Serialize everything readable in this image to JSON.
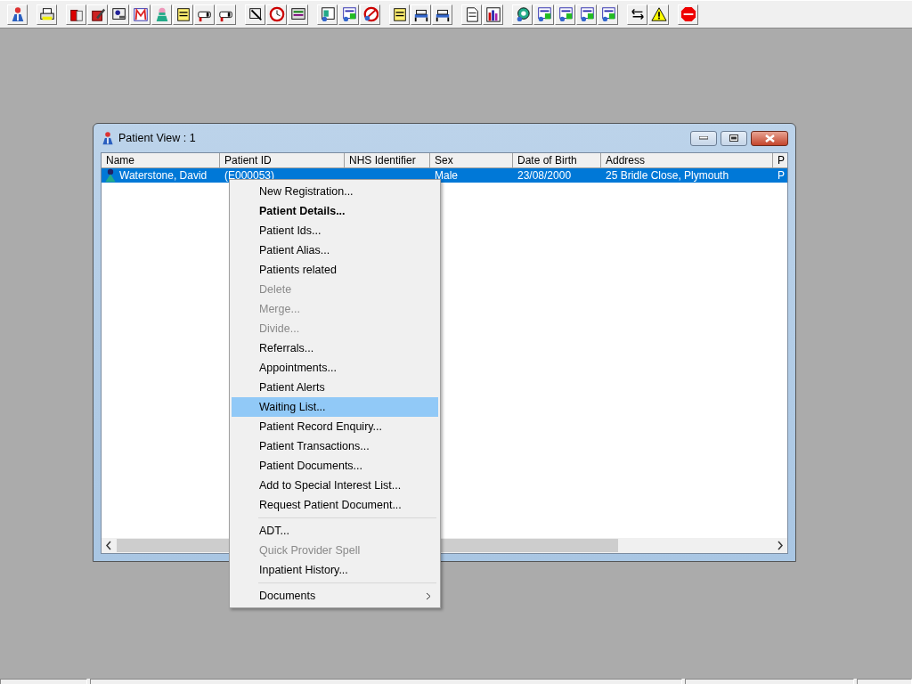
{
  "window": {
    "title": "Patient View : 1"
  },
  "table": {
    "columns": [
      "Name",
      "Patient ID",
      "NHS Identifier",
      "Sex",
      "Date of Birth",
      "Address",
      "P"
    ],
    "rows": [
      {
        "selected": true,
        "cells": [
          "Waterstone, David",
          "(E000053)",
          "",
          "Male",
          "23/08/2000",
          "25 Bridle Close, Plymouth",
          "P"
        ]
      }
    ]
  },
  "context_menu": {
    "groups": [
      [
        {
          "label": "New Registration...",
          "default": false,
          "disabled": false,
          "selected": false,
          "has_submenu": false
        },
        {
          "label": "Patient Details...",
          "default": true,
          "disabled": false,
          "selected": false,
          "has_submenu": false
        },
        {
          "label": "Patient Ids...",
          "default": false,
          "disabled": false,
          "selected": false,
          "has_submenu": false
        },
        {
          "label": "Patient Alias...",
          "default": false,
          "disabled": false,
          "selected": false,
          "has_submenu": false
        },
        {
          "label": "Patients related",
          "default": false,
          "disabled": false,
          "selected": false,
          "has_submenu": false
        },
        {
          "label": "Delete",
          "default": false,
          "disabled": true,
          "selected": false,
          "has_submenu": false
        },
        {
          "label": "Merge...",
          "default": false,
          "disabled": true,
          "selected": false,
          "has_submenu": false
        },
        {
          "label": "Divide...",
          "default": false,
          "disabled": true,
          "selected": false,
          "has_submenu": false
        },
        {
          "label": "Referrals...",
          "default": false,
          "disabled": false,
          "selected": false,
          "has_submenu": false
        },
        {
          "label": "Appointments...",
          "default": false,
          "disabled": false,
          "selected": false,
          "has_submenu": false
        },
        {
          "label": "Patient Alerts",
          "default": false,
          "disabled": false,
          "selected": false,
          "has_submenu": false
        },
        {
          "label": "Waiting List...",
          "default": false,
          "disabled": false,
          "selected": true,
          "has_submenu": false
        },
        {
          "label": "Patient Record Enquiry...",
          "default": false,
          "disabled": false,
          "selected": false,
          "has_submenu": false
        },
        {
          "label": "Patient Transactions...",
          "default": false,
          "disabled": false,
          "selected": false,
          "has_submenu": false
        },
        {
          "label": "Patient Documents...",
          "default": false,
          "disabled": false,
          "selected": false,
          "has_submenu": false
        },
        {
          "label": "Add to Special Interest List...",
          "default": false,
          "disabled": false,
          "selected": false,
          "has_submenu": false
        },
        {
          "label": "Request Patient Document...",
          "default": false,
          "disabled": false,
          "selected": false,
          "has_submenu": false
        }
      ],
      [
        {
          "label": "ADT...",
          "default": false,
          "disabled": false,
          "selected": false,
          "has_submenu": false
        },
        {
          "label": "Quick Provider Spell",
          "default": false,
          "disabled": true,
          "selected": false,
          "has_submenu": false
        },
        {
          "label": "Inpatient History...",
          "default": false,
          "disabled": false,
          "selected": false,
          "has_submenu": false
        }
      ],
      [
        {
          "label": "Documents",
          "default": false,
          "disabled": false,
          "selected": false,
          "has_submenu": true
        }
      ]
    ]
  }
}
